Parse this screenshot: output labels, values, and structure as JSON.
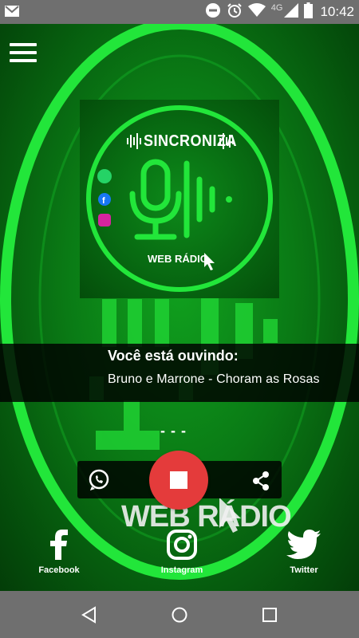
{
  "status_bar": {
    "network": "4G",
    "time": "10:42"
  },
  "now_playing": {
    "label": "Você está ouvindo:",
    "song": "Bruno e Marrone - Choram as Rosas",
    "dashes": "- - -"
  },
  "logo": {
    "brand": "SINCRONIZA",
    "tagline": "WEB RÁDIO"
  },
  "social": {
    "facebook": "Facebook",
    "instagram": "Instagram",
    "twitter": "Twitter"
  },
  "colors": {
    "accent_green": "#22e63a",
    "stop_red": "#e43b3b",
    "system_bar": "#6f6f6f"
  }
}
